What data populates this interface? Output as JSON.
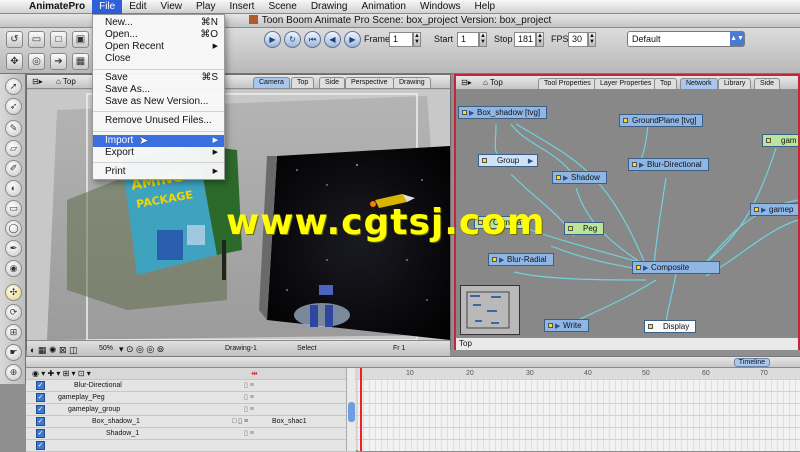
{
  "menubar": {
    "app": "AnimatePro",
    "items": [
      "File",
      "Edit",
      "View",
      "Play",
      "Insert",
      "Scene",
      "Drawing",
      "Animation",
      "Windows",
      "Help"
    ]
  },
  "window": {
    "title": "Toon Boom Animate Pro Scene: box_project Version: box_project"
  },
  "file_menu": {
    "items": [
      {
        "label": "New...",
        "shortcut": "⌘N"
      },
      {
        "label": "Open...",
        "shortcut": "⌘O"
      },
      {
        "label": "Open Recent",
        "submenu": "▶"
      },
      {
        "label": "Close"
      },
      {
        "label": "Save",
        "shortcut": "⌘S"
      },
      {
        "label": "Save As..."
      },
      {
        "label": "Save as New Version..."
      },
      {
        "label": "Remove Unused Files..."
      },
      {
        "label": "Import",
        "submenu": "▶"
      },
      {
        "label": "Export",
        "submenu": "▶"
      },
      {
        "label": "Print",
        "submenu": "▶"
      }
    ]
  },
  "toolbar": {
    "frame_label": "Frame",
    "frame_value": "1",
    "start_label": "Start",
    "start_value": "1",
    "stop_label": "Stop",
    "stop_value": "181",
    "fps_label": "FPS",
    "fps_value": "30",
    "layout_value": "Default"
  },
  "camera_panel": {
    "home_label": "Top",
    "tabs": [
      "Camera",
      "Top",
      "Side",
      "Perspective",
      "Drawing"
    ],
    "status": {
      "zoom": "50%",
      "drawing": "Drawing-1",
      "tool": "Select",
      "frame": "Fr 1"
    }
  },
  "network_panel": {
    "home_label": "Top",
    "tabs": [
      "Tool Properties",
      "Layer Properties",
      "Top",
      "Network",
      "Library",
      "Side"
    ],
    "nodes": {
      "box_shadow": "Box_shadow [tvg]",
      "groundplane": "GroundPlane [tvg]",
      "gam_right": "gam",
      "group": "Group",
      "blur_directional": "Blur-Directional",
      "shadow": "Shadow",
      "gamep": "gamep",
      "camera": "Camera",
      "peg": "Peg",
      "blur_radial": "Blur-Radial",
      "composite": "Composite",
      "write": "Write",
      "display": "Display"
    },
    "status": "Top"
  },
  "timeline": {
    "tab": "Timeline",
    "frame_numbers": [
      "10",
      "20",
      "30",
      "40",
      "50",
      "60",
      "70"
    ],
    "layers": [
      {
        "name": "Blur-Directional"
      },
      {
        "name": "gameplay_Peg"
      },
      {
        "name": "gameplay_group"
      },
      {
        "name": "Box_shadow_1",
        "drawing": "Box_shac1"
      },
      {
        "name": "Shadow_1"
      }
    ]
  },
  "watermark": "www.cgtsj.com",
  "colors": {
    "menu_highlight": "#3b6fde",
    "panel_border_active": "#c5243b",
    "node_blue": "#8fb6e5"
  }
}
